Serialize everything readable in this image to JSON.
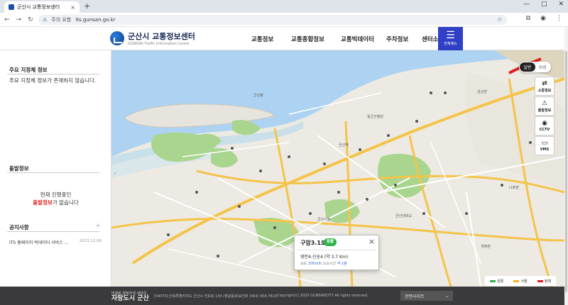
{
  "browser": {
    "tab_title": "군산시 교통정보센터",
    "tab_close": "×",
    "new_tab": "+",
    "security_label": "주의 요함",
    "url": "its.gunsan.go.kr"
  },
  "header": {
    "logo_title": "군산시 교통정보센터",
    "logo_subtitle": "GUNSAN Traffic Information Center",
    "nav": [
      "교통정보",
      "교통종합정보",
      "교통빅데이터",
      "주차정보",
      "센터소개"
    ],
    "all_menu_label": "전체메뉴"
  },
  "sidebar": {
    "designated": {
      "title": "주요 지정체 정보",
      "empty_text": "주요 지정체 정보가 존재하지 않습니다."
    },
    "event": {
      "title": "돌발정보",
      "line1": "현재 진행중인",
      "highlight": "돌발정보",
      "line2_rest": "가 없습니다"
    },
    "notice": {
      "title": "공지사항",
      "more": "+",
      "items": [
        {
          "title": "ITS 홈페이지 빅데이터 서비스 ...",
          "date": "2023.12.06"
        }
      ]
    }
  },
  "map": {
    "type_options": [
      "일반",
      "위성"
    ],
    "layers": [
      {
        "label": "소통정보",
        "icon": "traffic-arrows-icon"
      },
      {
        "label": "돌발정보",
        "icon": "alert-light-icon"
      },
      {
        "label": "CCTV",
        "icon": "cctv-icon"
      },
      {
        "label": "VMS",
        "icon": "vms-board-icon"
      }
    ],
    "labels": {
      "sunsan": "성산면",
      "gunsan_port": "군산항",
      "city_hall": "군산시청",
      "najo": "나포면",
      "gaejeong": "개정면",
      "kunsan_univ": "군산대학교",
      "kunsan_station": "군산역",
      "hosp": "동군산병원"
    },
    "popup": {
      "road": "구암3.1로",
      "status": "원활",
      "section": "영안4-신송4 (약 3.7 Km)",
      "speed_label": "속도",
      "speed_value": "37Km/h",
      "time_label": "소요시간",
      "time_value": "약 1분",
      "close": "×"
    },
    "legend": [
      {
        "label": "원활",
        "color": "#2fb24a"
      },
      {
        "label": "서행",
        "color": "#f2b51c"
      },
      {
        "label": "정체",
        "color": "#e02020"
      }
    ]
  },
  "footer": {
    "slogan_small": "미래로 행복하게 새만금",
    "slogan_big": "자랑도시 군산",
    "address": "[54070] 전북특별자치도 군산시 진포로 134 (영광동)",
    "tel": "대표전화 (063) 454-7810",
    "copyright": "Copyright(c) 2020 GUNSANCITY All rights reserved.",
    "related_sites": "관련사이트"
  }
}
